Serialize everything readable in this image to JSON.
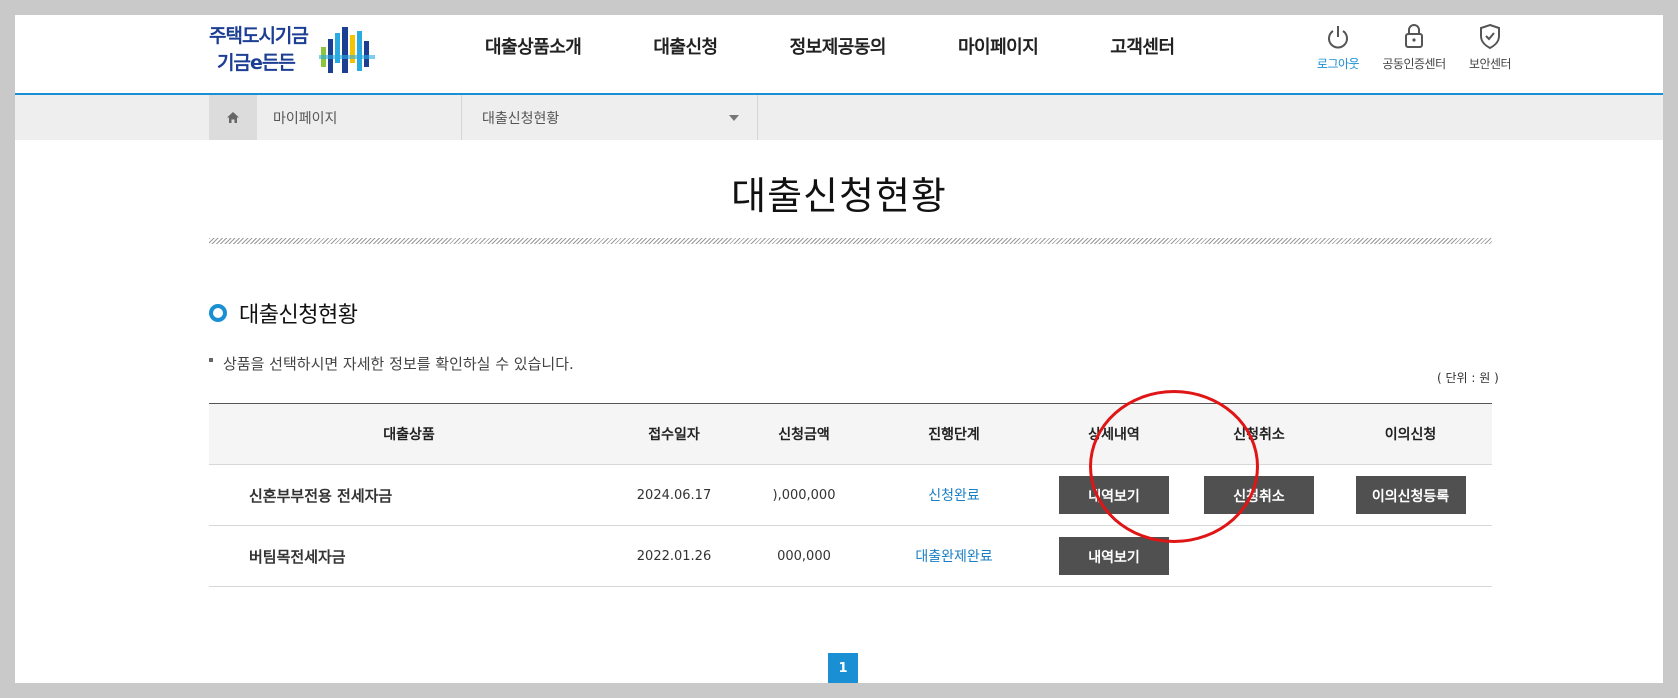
{
  "logo": {
    "line1": "주택도시기금",
    "line2": "기금e든든"
  },
  "gnb": [
    "대출상품소개",
    "대출신청",
    "정보제공동의",
    "마이페이지",
    "고객센터"
  ],
  "util": [
    {
      "label": "로그아웃",
      "icon": "power-icon",
      "active": true
    },
    {
      "label": "공동인증센터",
      "icon": "lock-icon",
      "active": false
    },
    {
      "label": "보안센터",
      "icon": "shield-icon",
      "active": false
    }
  ],
  "breadcrumb": {
    "level1": "마이페이지",
    "level2": "대출신청현황"
  },
  "page_title": "대출신청현황",
  "section_title": "대출신청현황",
  "note": "상품을 선택하시면 자세한 정보를 확인하실 수 있습니다.",
  "unit": "( 단위 : 원 )",
  "table": {
    "headers": [
      "대출상품",
      "접수일자",
      "신청금액",
      "진행단계",
      "상세내역",
      "신청취소",
      "이의신청"
    ],
    "rows": [
      {
        "product": "신혼부부전용 전세자금",
        "date": "2024.06.17",
        "amount": "),000,000",
        "status": "신청완료",
        "detail_btn": "내역보기",
        "cancel_btn": "신청취소",
        "appeal_btn": "이의신청등록"
      },
      {
        "product": "버팀목전세자금",
        "date": "2022.01.26",
        "amount": "000,000",
        "status": "대출완제완료",
        "detail_btn": "내역보기"
      }
    ]
  },
  "pagination": {
    "current": "1"
  },
  "colors": {
    "accent": "#1a8fd3",
    "button": "#505050",
    "highlight": "#e01515"
  }
}
